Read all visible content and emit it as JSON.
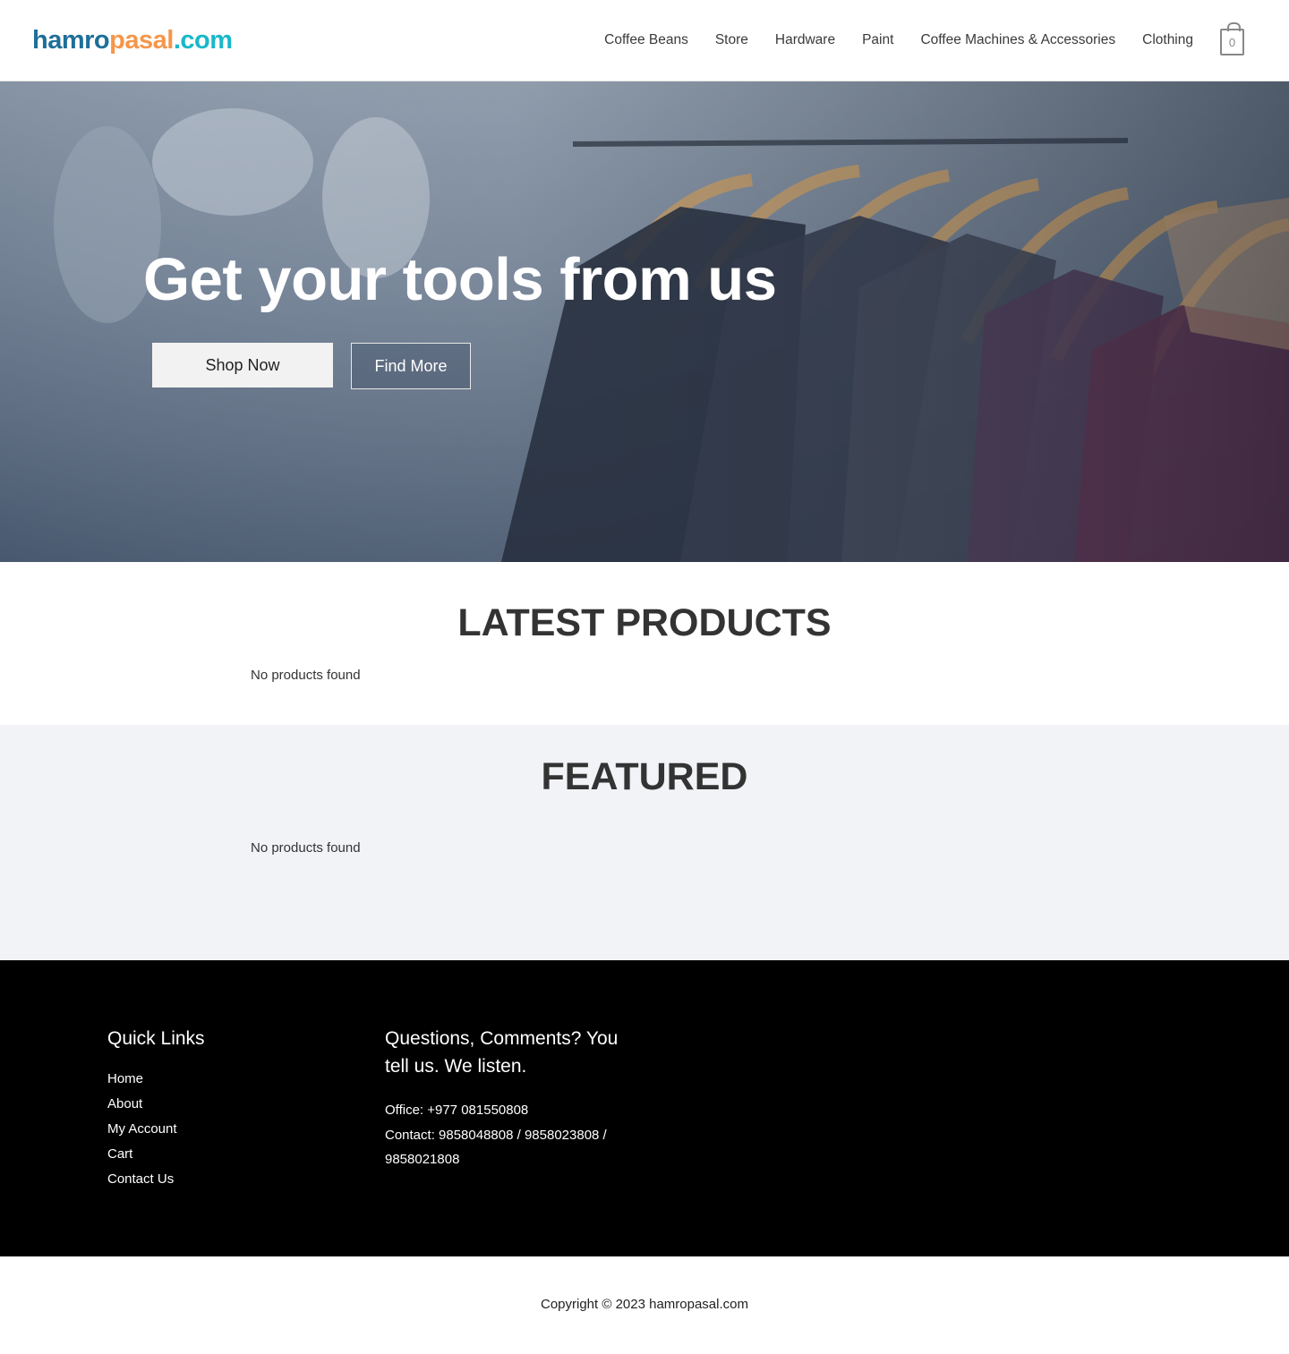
{
  "header": {
    "logo": {
      "part1": "hamro",
      "part2": "pasal",
      "part3": ".com"
    },
    "nav": [
      "Coffee Beans",
      "Store",
      "Hardware",
      "Paint",
      "Coffee Machines & Accessories",
      "Clothing"
    ],
    "cart_count": "0"
  },
  "hero": {
    "title": "Get your tools from us",
    "shop_label": "Shop Now",
    "find_label": "Find More"
  },
  "latest": {
    "title": "LATEST PRODUCTS",
    "empty_text": "No products found"
  },
  "featured": {
    "title": "FEATURED",
    "empty_text": "No products found"
  },
  "footer": {
    "quick_links_title": "Quick Links",
    "links": [
      "Home",
      "About",
      "My Account",
      "Cart",
      "Contact Us"
    ],
    "contact_title": "Questions, Comments? You tell us. We listen.",
    "office": "Office: +977 081550808",
    "contact": "Contact: 9858048808 / 9858023808 / 9858021808"
  },
  "copyright": "Copyright © 2023 hamropasal.com",
  "colors": {
    "logo_blue": "#1f6f9a",
    "logo_orange": "#f5964a",
    "logo_teal": "#19b8c9",
    "featured_bg": "#f2f3f7",
    "footer_bg": "#000000"
  }
}
